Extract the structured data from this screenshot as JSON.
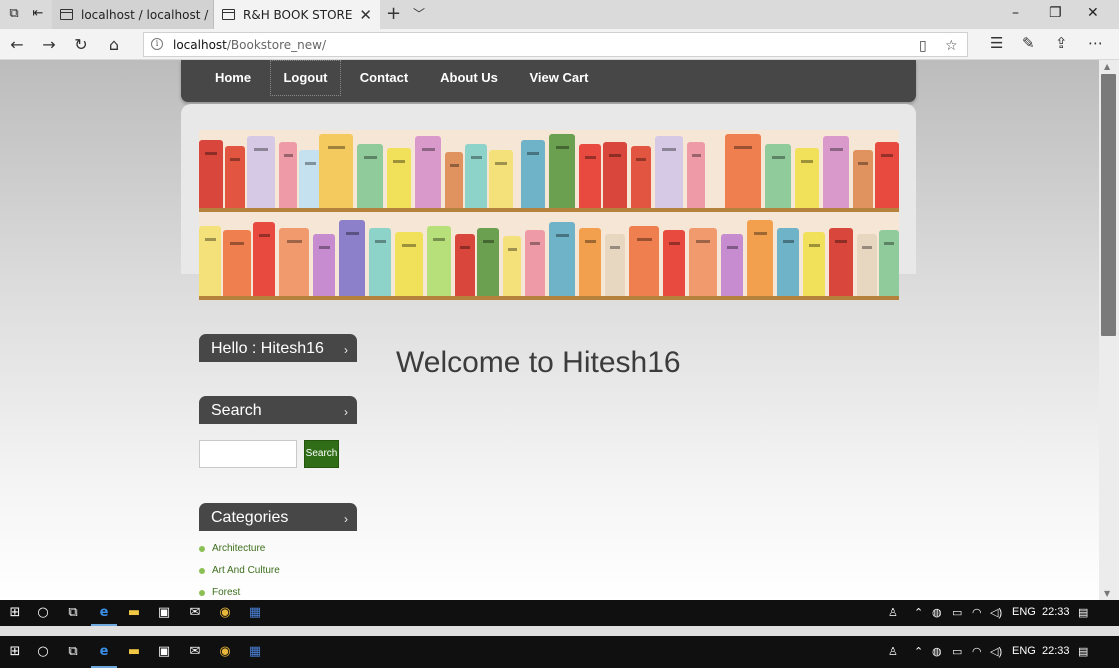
{
  "browser": {
    "tabs": [
      {
        "label": "localhost / localhost / book",
        "active": false
      },
      {
        "label": "R&H BOOK STORE",
        "active": true
      }
    ],
    "url_host": "localhost",
    "url_path": "/Bookstore_new/",
    "window_controls": {
      "minimize": "–",
      "restore": "❐",
      "close": "✕"
    }
  },
  "nav": {
    "items": [
      {
        "label": "Home"
      },
      {
        "label": "Logout"
      },
      {
        "label": "Contact"
      },
      {
        "label": "About Us"
      },
      {
        "label": "View Cart"
      }
    ],
    "selected": "Logout"
  },
  "sidebar": {
    "hello_title": "Hello : Hitesh16",
    "search_title": "Search",
    "search_input_value": "",
    "search_button_label": "Search",
    "categories_title": "Categories",
    "categories": [
      "Architecture",
      "Art And Culture",
      "Forest"
    ]
  },
  "main": {
    "welcome_text": "Welcome to Hitesh16"
  },
  "colors": {
    "nav_bg": "#474747",
    "search_button": "#2f6e17",
    "category_link": "#3d6f1c"
  },
  "taskbar": {
    "language": "ENG",
    "time": "22:33",
    "icons": [
      "windows-icon",
      "cortana-icon",
      "task-view-icon",
      "edge-icon",
      "file-explorer-icon",
      "store-icon",
      "mail-icon",
      "chrome-icon",
      "word-icon"
    ]
  }
}
